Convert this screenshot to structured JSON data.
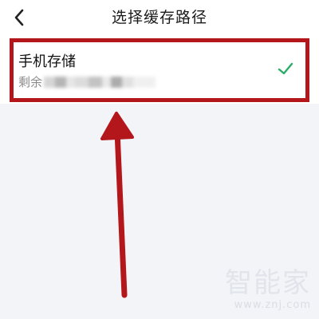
{
  "header": {
    "title": "选择缓存路径",
    "back_icon": "chevron-left-icon"
  },
  "storage": {
    "title": "手机存储",
    "remaining_label": "剩余",
    "selected_icon": "checkmark-icon",
    "check_color": "#2aae67"
  },
  "annotation": {
    "highlight_color": "#b3161b"
  },
  "watermark": {
    "brand": "智能家",
    "url": "www.znj.com"
  }
}
